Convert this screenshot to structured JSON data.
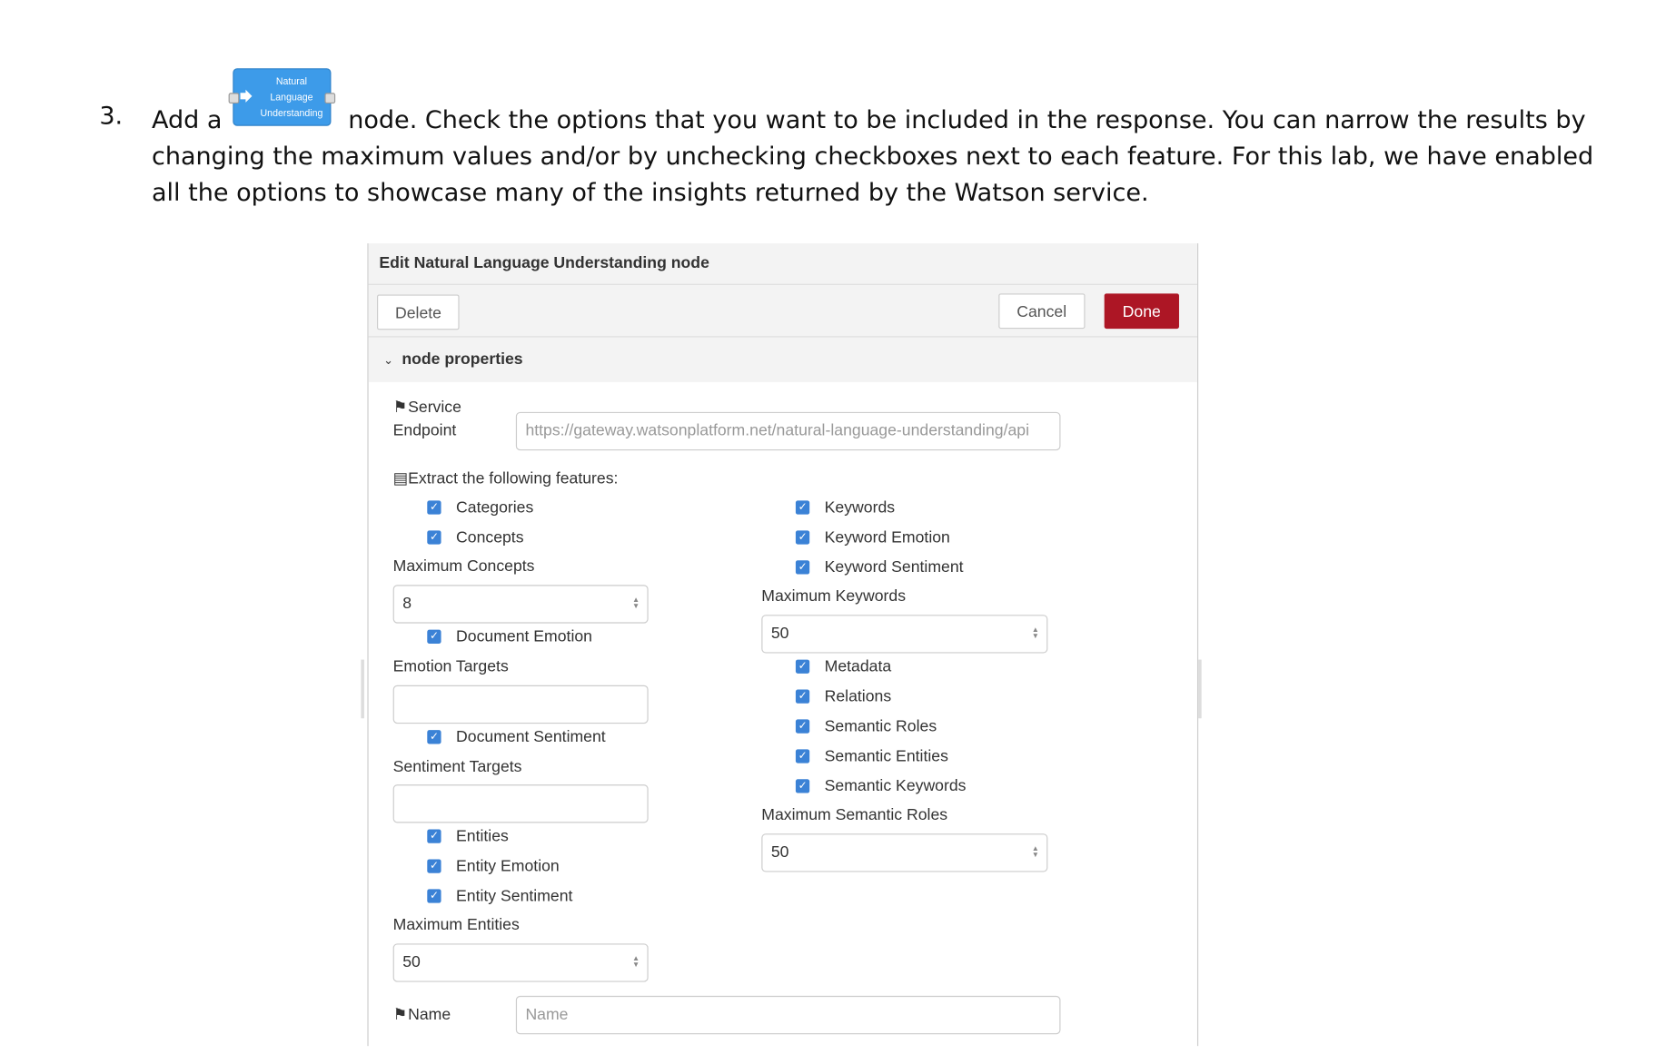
{
  "instruction": {
    "number": "3.",
    "text_before": "Add a",
    "text_after": "node. Check the options that you want to be included in the response. You can narrow the results by changing the maximum values and/or by unchecking checkboxes next to each feature. For this lab, we have enabled all the options to showcase many of the insights returned by the Watson service.",
    "node_label_lines": [
      "Natural",
      "Language",
      "Understanding"
    ],
    "node_color": "#3d9be9"
  },
  "dialog": {
    "title": "Edit Natural Language Understanding node",
    "delete_label": "Delete",
    "cancel_label": "Cancel",
    "done_label": "Done",
    "done_color": "#ad1625",
    "section_label": "node properties",
    "service_label_line1": "Service",
    "service_label_line2": "Endpoint",
    "service_endpoint": "https://gateway.watsonplatform.net/natural-language-understanding/api",
    "extract_label": "Extract the following features:",
    "left_features": {
      "categories": "Categories",
      "concepts": "Concepts",
      "max_concepts_label": "Maximum Concepts",
      "max_concepts_value": "8",
      "document_emotion": "Document Emotion",
      "emotion_targets_label": "Emotion Targets",
      "emotion_targets_value": "",
      "document_sentiment": "Document Sentiment",
      "sentiment_targets_label": "Sentiment Targets",
      "sentiment_targets_value": "",
      "entities": "Entities",
      "entity_emotion": "Entity Emotion",
      "entity_sentiment": "Entity Sentiment",
      "max_entities_label": "Maximum Entities",
      "max_entities_value": "50"
    },
    "right_features": {
      "keywords": "Keywords",
      "keyword_emotion": "Keyword Emotion",
      "keyword_sentiment": "Keyword Sentiment",
      "max_keywords_label": "Maximum Keywords",
      "max_keywords_value": "50",
      "metadata": "Metadata",
      "relations": "Relations",
      "semantic_roles": "Semantic Roles",
      "semantic_entities": "Semantic Entities",
      "semantic_keywords": "Semantic Keywords",
      "max_semantic_roles_label": "Maximum Semantic Roles",
      "max_semantic_roles_value": "50"
    },
    "name_label": "Name",
    "name_placeholder": "Name",
    "checkbox_color": "#3b82d6"
  }
}
